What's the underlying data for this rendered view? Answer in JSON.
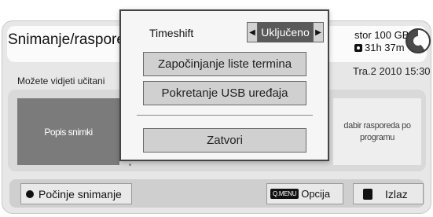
{
  "background": {
    "title": "Snimanje/raspore",
    "storage_line1": "stor 100 GB",
    "storage_line2": "31h 37m",
    "storage_free_fraction": 0.4,
    "info_text": "Možete vidjeti učitani",
    "date_text": "Tra.2 2010 15:30",
    "tiles": {
      "recorded_list": "Popis snimki",
      "schedule_by_program": "dabir rasporeda po programu"
    },
    "bottom_bar": {
      "record_label": "Počinje snimanje",
      "qmenu_icon": "Q.MENU",
      "options_label": "Opcija",
      "exit_label": "Izlaz"
    }
  },
  "popup": {
    "timeshift_label": "Timeshift",
    "timeshift_value": "Uključeno",
    "buttons": {
      "schedule_list": "Započinjanje liste termina",
      "usb_device": "Pokretanje USB uređaja",
      "close": "Zatvori"
    }
  },
  "icons": {
    "left_arrow": "◀",
    "right_arrow": "▶"
  }
}
